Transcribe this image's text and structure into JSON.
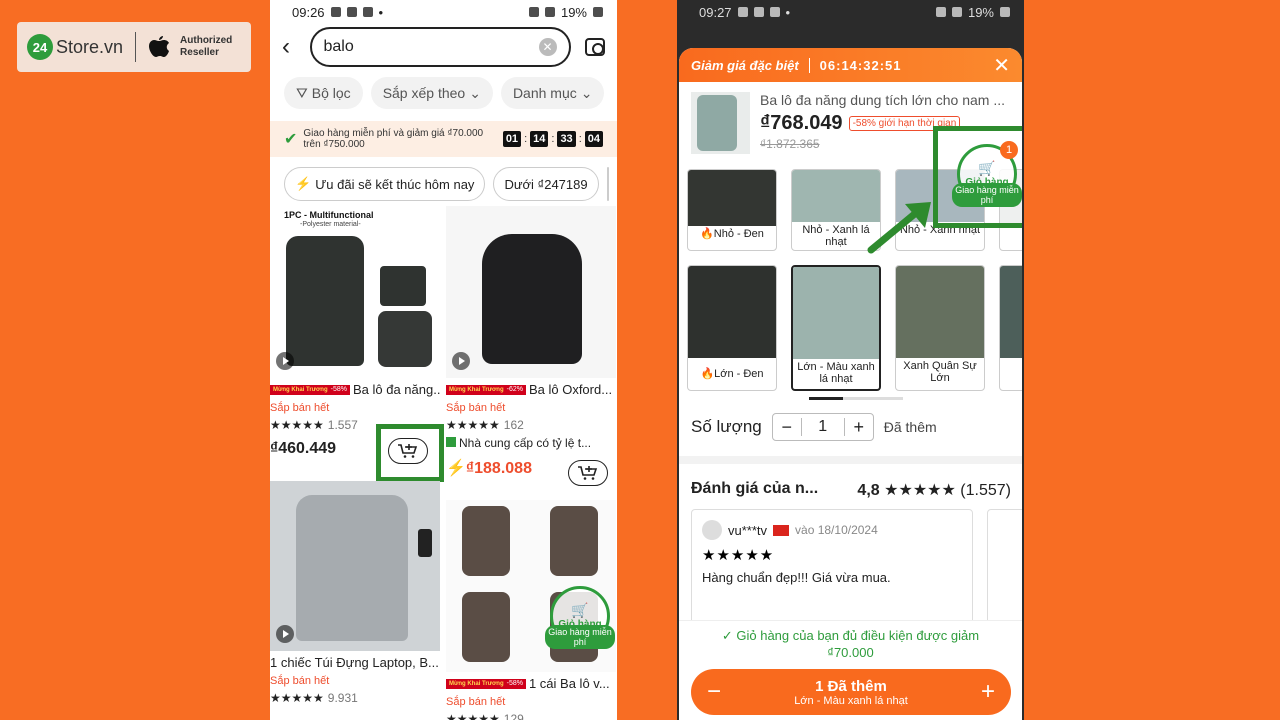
{
  "logo": {
    "brand_num": "24",
    "brand": "Store.vn",
    "reseller_line1": "Authorized",
    "reseller_line2": "Reseller"
  },
  "left": {
    "status": {
      "time": "09:26",
      "battery": "19%"
    },
    "search": {
      "value": "balo"
    },
    "filters": [
      "Bộ lọc",
      "Sắp xếp theo",
      "Danh mục"
    ],
    "shipping": {
      "text": "Giao hàng miễn phí và giảm giá ₫70.000 trên ₫750.000",
      "timer": [
        "01",
        "14",
        "33",
        "04"
      ]
    },
    "chips": [
      "Ưu đãi sẽ kết thúc hôm nay",
      "Dưới ₫247189"
    ],
    "products": [
      {
        "promo_a": "Mừng Khai Trương",
        "promo_b": "-58%",
        "title": "Ba lô đa năng...",
        "sold": "Sắp bán hết",
        "stars": "★★★★★",
        "count": "1.557",
        "price": "₫460.449",
        "img_text_1": "1PC - Multifunctional",
        "img_text_2": "-Polyester material-"
      },
      {
        "promo_a": "Mừng Khai Trương",
        "promo_b": "-62%",
        "title": "Ba lô Oxford...",
        "sold": "Sắp bán hết",
        "stars": "★★★★★",
        "count": "162",
        "supplier": "Nhà cung cấp có tỷ lệ t...",
        "price": "₫188.088"
      },
      {
        "title": "1 chiếc Túi Đựng Laptop, B...",
        "sold": "Sắp bán hết",
        "stars": "★★★★★",
        "count": "9.931"
      },
      {
        "promo_a": "Mừng Khai Trương",
        "promo_b": "-58%",
        "title": "1 cái Ba lô v...",
        "sold": "Sắp bán hết",
        "stars": "★★★★★",
        "count": "129",
        "cart_label": "Giỏ hàng",
        "cart_ship": "Giao hàng miễn phí"
      }
    ]
  },
  "right": {
    "status": {
      "time": "09:27",
      "battery": "19%"
    },
    "sheet": {
      "header": "Giảm giá đặc biệt",
      "countdown": "06:14:32:51",
      "title": "Ba lô đa năng dung tích lớn cho nam ...",
      "price": "₫768.049",
      "badge": "-58% giới hạn thời gian",
      "old_price": "₫1.872.365",
      "cart_label": "Giỏ hàng",
      "cart_ship": "Giao hàng miễn phí",
      "cart_count": "1"
    },
    "variants": [
      {
        "label": "Nhỏ - Đen",
        "flame": true
      },
      {
        "label": "Nhỏ - Xanh lá nhạt"
      },
      {
        "label": "Nhỏ - Xanh nhạt"
      },
      {
        "label": "Lớn - Đen",
        "flame": true
      },
      {
        "label": "Lớn - Màu xanh lá nhạt",
        "selected": true
      },
      {
        "label": "Xanh Quân Sự Lớn"
      }
    ],
    "quantity": {
      "label": "Số lượng",
      "value": "1",
      "added": "Đã thêm"
    },
    "reviews": {
      "title": "Đánh giá của n...",
      "rating": "4,8",
      "stars": "★★★★★",
      "count": "(1.557)"
    },
    "review": {
      "user": "vu***tv",
      "date": "vào 18/10/2024",
      "stars": "★★★★★",
      "text": "Hàng chuẩn đẹp!!! Giá vừa mua."
    },
    "footer": {
      "message": "✓ Giỏ hàng của bạn đủ điều kiện được giảm ₫70.000",
      "btn_main": "1 Đã thêm",
      "btn_sub": "Lớn - Màu xanh lá nhạt"
    }
  },
  "colors": {
    "background": "#f86d23",
    "accent": "#ee4d2d",
    "highlight": "#2e8b2e"
  }
}
